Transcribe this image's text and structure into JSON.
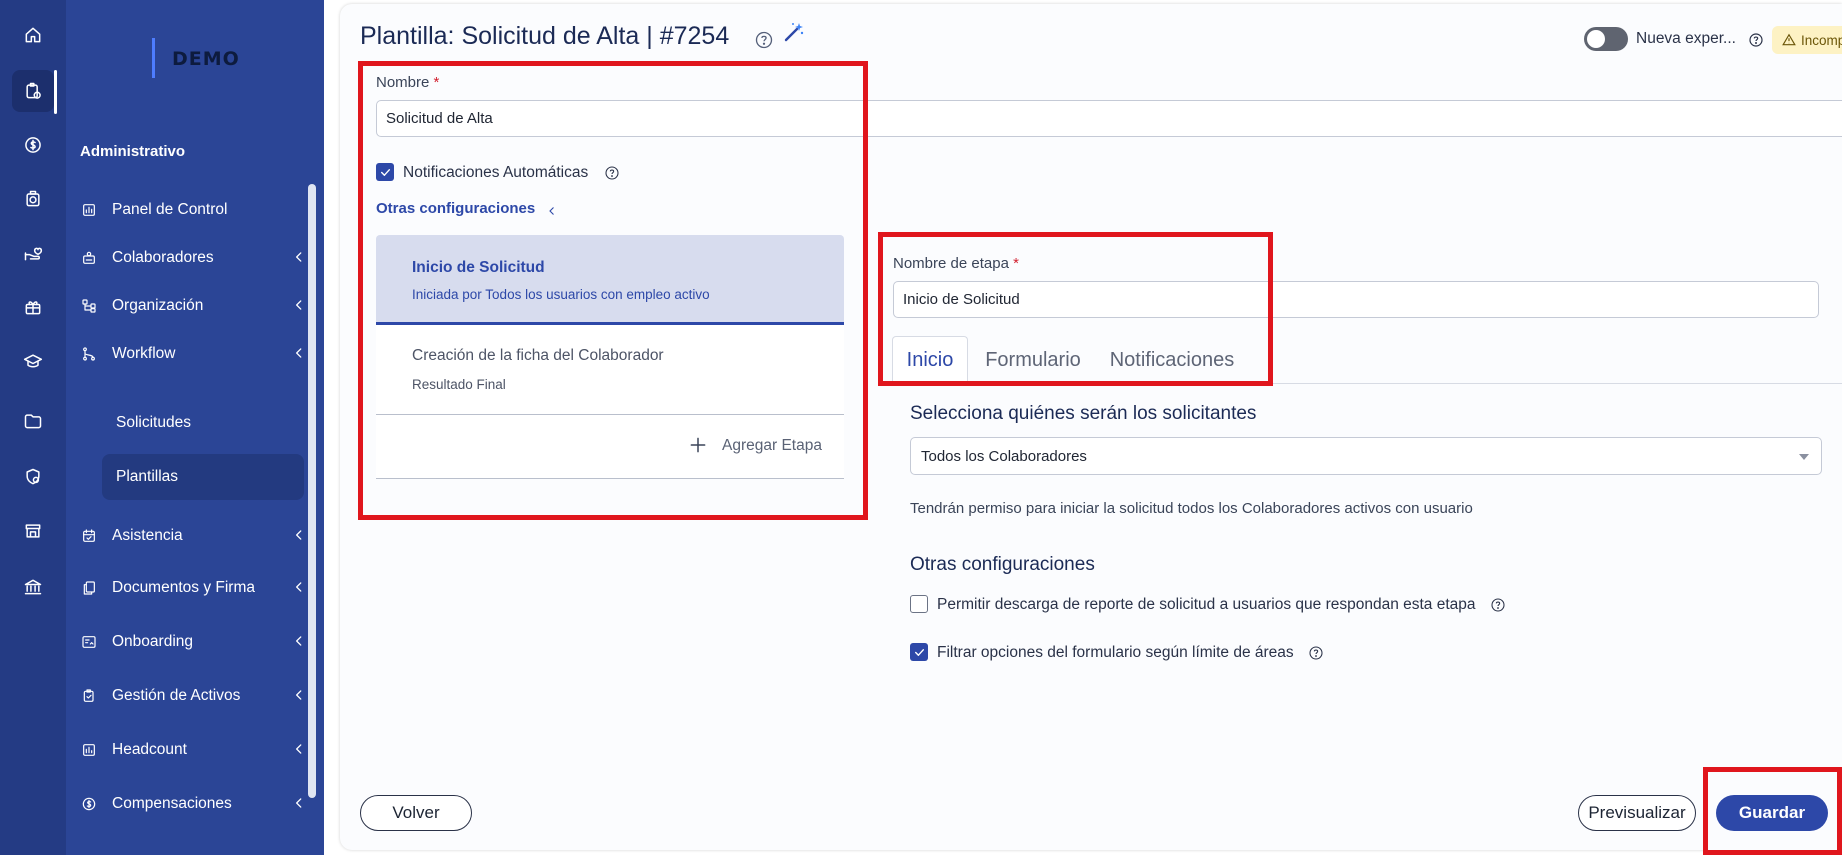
{
  "brand": {
    "logo_text": "DEMO"
  },
  "colors": {
    "rail_bg": "#243b84",
    "sidebar_bg": "#2b4596",
    "accent": "#2d48a8",
    "highlight": "#e0161d",
    "warning_bg": "#fdf2c4"
  },
  "rail": {
    "icons": [
      "home-icon",
      "clipboard-clock-icon",
      "dollar-circle-icon",
      "clock-badge-icon",
      "hand-heart-icon",
      "gift-icon",
      "graduation-cap-icon",
      "folder-icon",
      "shield-lock-icon",
      "store-icon",
      "bank-icon"
    ]
  },
  "sidebar": {
    "section_title": "Administrativo",
    "items": [
      {
        "label": "Panel de Control",
        "icon": "chart-icon",
        "expandable": false
      },
      {
        "label": "Colaboradores",
        "icon": "users-icon",
        "expandable": true
      },
      {
        "label": "Organización",
        "icon": "org-chart-icon",
        "expandable": true
      },
      {
        "label": "Workflow",
        "icon": "workflow-icon",
        "expandable": true
      },
      {
        "label": "Asistencia",
        "icon": "calendar-check-icon",
        "expandable": true
      },
      {
        "label": "Documentos y Firma",
        "icon": "documents-icon",
        "expandable": true
      },
      {
        "label": "Onboarding",
        "icon": "onboarding-icon",
        "expandable": true
      },
      {
        "label": "Gestión de Activos",
        "icon": "assets-icon",
        "expandable": true
      },
      {
        "label": "Headcount",
        "icon": "headcount-icon",
        "expandable": true
      },
      {
        "label": "Compensaciones",
        "icon": "dollar-icon",
        "expandable": true
      }
    ],
    "workflow_sub": [
      "Solicitudes",
      "Plantillas"
    ],
    "selected_sub": "Plantillas"
  },
  "header": {
    "title": "Plantilla: Solicitud de Alta | #7254",
    "toggle_label": "Nueva exper...",
    "toggle_on": false,
    "warning_badge": "Incomp"
  },
  "form": {
    "name_label": "Nombre",
    "required_mark": "*",
    "name_value": "Solicitud de Alta",
    "auto_notifications_label": "Notificaciones Automáticas",
    "auto_notifications_checked": true,
    "other_settings_link": "Otras configuraciones"
  },
  "stages": [
    {
      "title": "Inicio de Solicitud",
      "subtitle": "Iniciada por Todos los usuarios con empleo activo",
      "active": true
    },
    {
      "title": "Creación de la ficha del Colaborador",
      "subtitle": "Resultado Final",
      "active": false
    }
  ],
  "add_stage_label": "Agregar Etapa",
  "stage_editor": {
    "name_label": "Nombre de etapa",
    "name_value": "Inicio de Solicitud",
    "tabs": [
      "Inicio",
      "Formulario",
      "Notificaciones"
    ],
    "active_tab": "Inicio",
    "requesters_heading": "Selecciona quiénes serán los solicitantes",
    "requesters_value": "Todos los Colaboradores",
    "permission_text": "Tendrán permiso para iniciar la solicitud todos los Colaboradores activos con usuario",
    "other_settings_heading": "Otras configuraciones",
    "options": [
      {
        "label": "Permitir descarga de reporte de solicitud a usuarios que respondan esta etapa",
        "checked": false
      },
      {
        "label": "Filtrar opciones del formulario según límite de áreas",
        "checked": true
      }
    ]
  },
  "footer": {
    "back_label": "Volver",
    "preview_label": "Previsualizar",
    "save_label": "Guardar"
  }
}
